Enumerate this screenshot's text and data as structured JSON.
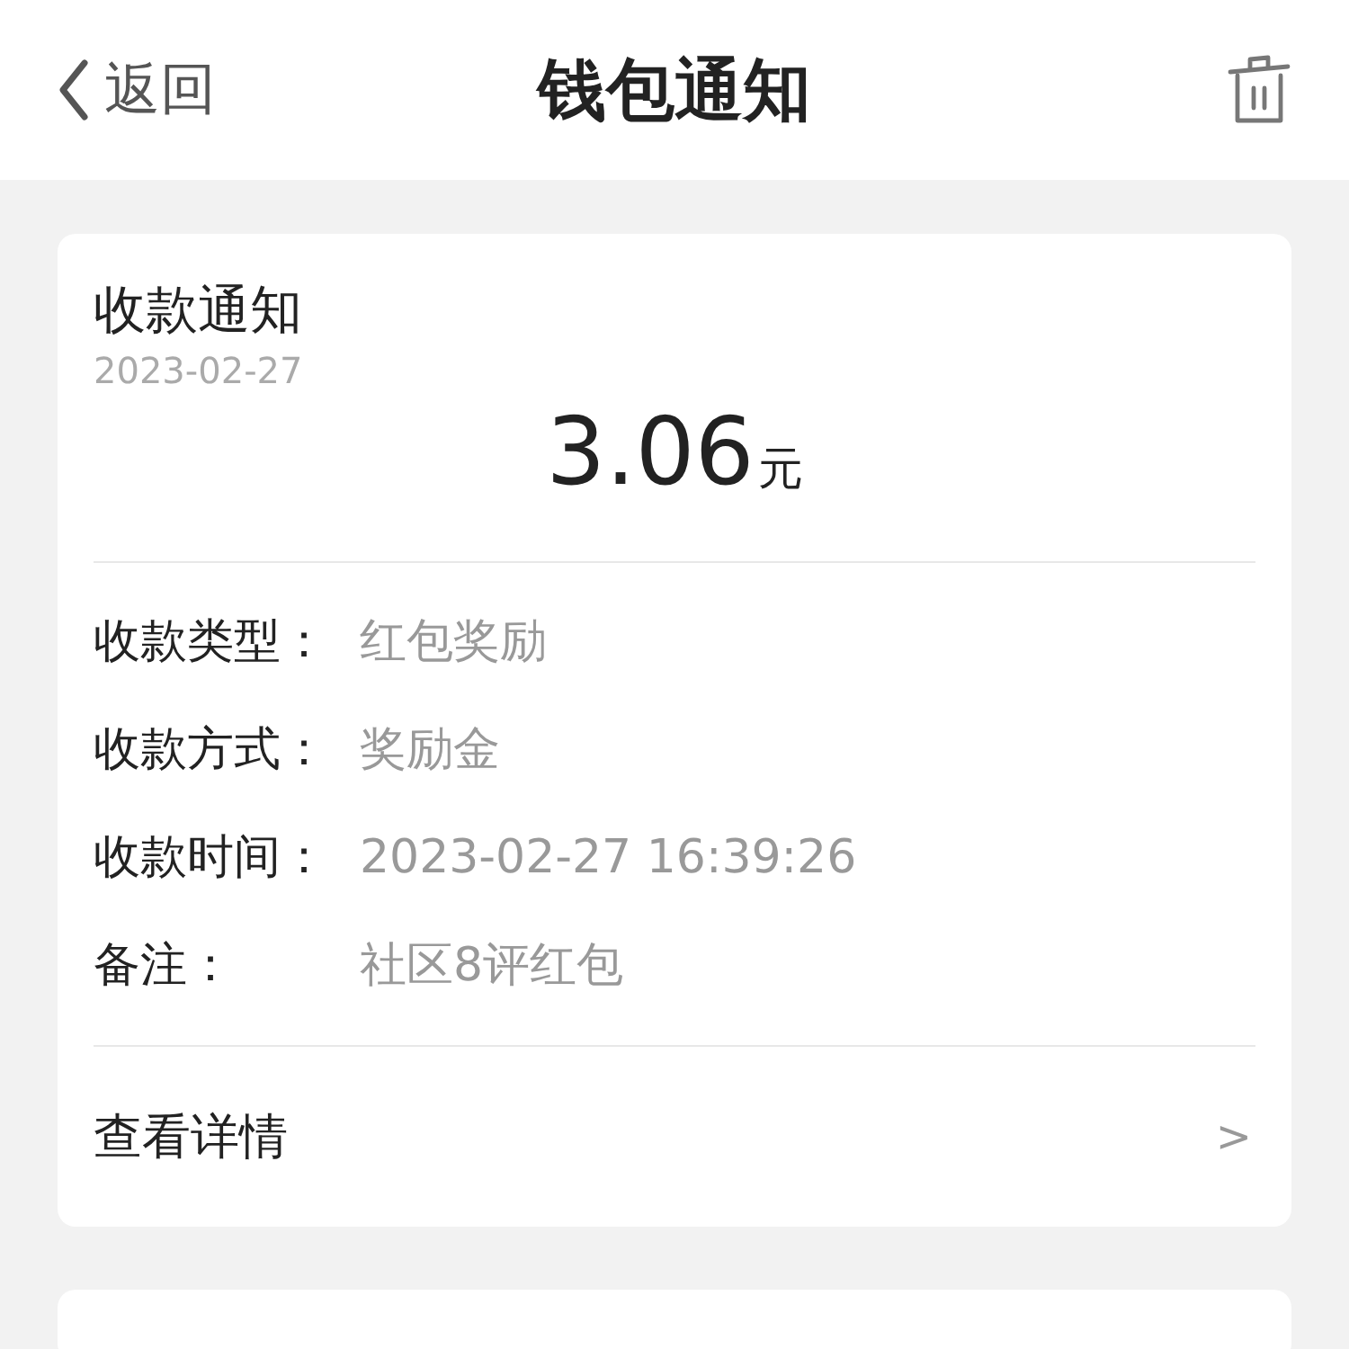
{
  "header": {
    "back": "返回",
    "title": "钱包通知"
  },
  "notice": {
    "title": "收款通知",
    "date": "2023-02-27",
    "amount": "3.06",
    "unit": "元",
    "fields": [
      {
        "label": "收款类型：",
        "value": "红包奖励"
      },
      {
        "label": "收款方式：",
        "value": "奖励金"
      },
      {
        "label": "收款时间：",
        "value": "2023-02-27 16:39:26"
      },
      {
        "label": "备注：",
        "value": "社区8评红包"
      }
    ],
    "details": {
      "label": "查看详情",
      "arrow": ">"
    }
  }
}
